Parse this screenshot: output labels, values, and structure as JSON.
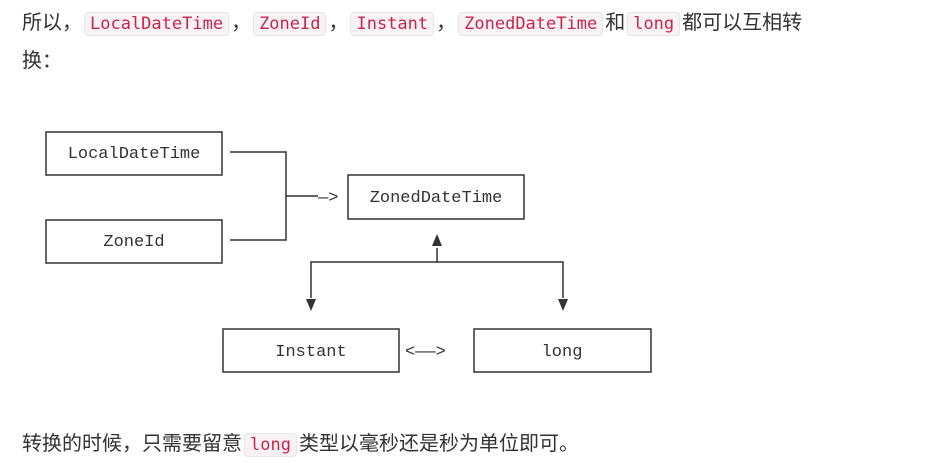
{
  "top_paragraph": {
    "prefix": "所以，",
    "sep1": "，",
    "sep2": "，",
    "sep3": "，",
    "conj": "和",
    "suffix_line1": "都可以互相转",
    "line2": "换：",
    "codes": [
      "LocalDateTime",
      "ZoneId",
      "Instant",
      "ZonedDateTime",
      "long"
    ]
  },
  "diagram": {
    "boxes": {
      "local_date_time": "LocalDateTime",
      "zone_id": "ZoneId",
      "zoned_date_time": "ZonedDateTime",
      "instant": "Instant",
      "long": "long"
    },
    "arrow_to_zoned": "—>",
    "arrow_instant_long": "<——>"
  },
  "bottom_paragraph": {
    "prefix": "转换的时候，只需要留意",
    "code": "long",
    "suffix": "类型以毫秒还是秒为单位即可。"
  }
}
